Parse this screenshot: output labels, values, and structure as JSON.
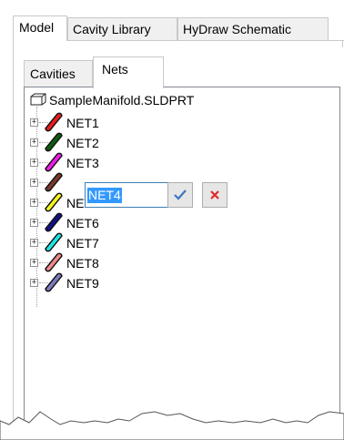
{
  "top_tabs": [
    "Model",
    "Cavity Library",
    "HyDraw Schematic"
  ],
  "inner_tabs": [
    "Cavities",
    "Nets"
  ],
  "tree": {
    "root_label": "SampleManifold.SLDPRT",
    "root_icon": "part-icon",
    "nets": [
      {
        "label": "NET1",
        "color": "#e81c1c"
      },
      {
        "label": "NET2",
        "color": "#0e5c0e"
      },
      {
        "label": "NET3",
        "color": "#f01ce8"
      },
      {
        "label": "NET4",
        "color": "#7a3a2c"
      },
      {
        "label": "NET5",
        "color": "#f5f51e"
      },
      {
        "label": "NET6",
        "color": "#121287"
      },
      {
        "label": "NET7",
        "color": "#1ee6e6"
      },
      {
        "label": "NET8",
        "color": "#f08a8a"
      },
      {
        "label": "NET9",
        "color": "#7b7bc0"
      }
    ]
  },
  "edit": {
    "value": "NET4",
    "confirm_icon": "checkmark-icon",
    "cancel_icon": "close-icon"
  }
}
